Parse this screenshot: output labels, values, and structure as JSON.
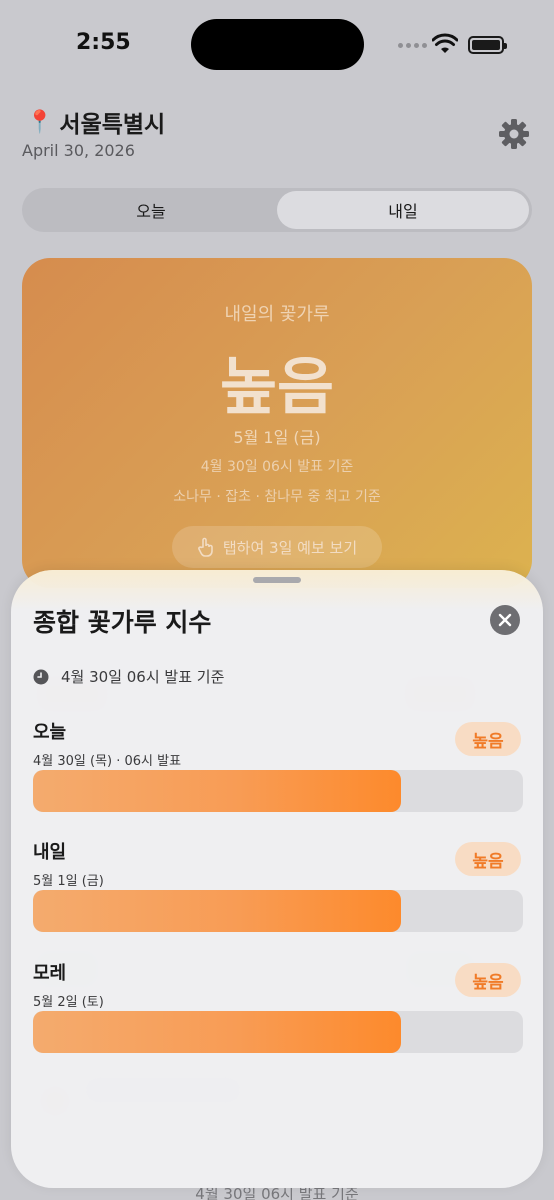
{
  "status_bar": {
    "time": "2:55"
  },
  "header": {
    "location_icon": "pin-icon",
    "city": "서울특별시",
    "date": "April 30, 2026",
    "settings_icon": "gear-icon"
  },
  "segment": {
    "tabs": [
      {
        "label": "오늘",
        "active": false
      },
      {
        "label": "내일",
        "active": true
      }
    ]
  },
  "hero": {
    "subtitle": "내일의 꽃가루",
    "level": "높음",
    "date": "5월 1일 (금)",
    "issued": "4월 30일 06시 발표 기준",
    "basis": "소나무 · 잡초 · 참나무 중 최고 기준",
    "button_label": "탭하여 3일 예보 보기",
    "button_icon": "tap-hand-icon",
    "color_from": "#d68c4e",
    "color_to": "#dcb24f"
  },
  "background_footer": "4월 30일 06시 발표 기준",
  "sheet": {
    "title": "종합 꽃가루 지수",
    "close_icon": "close-icon",
    "issued_icon": "clock-icon",
    "issued": "4월 30일 06시 발표 기준",
    "bar_color": "#fd8a2c",
    "badge_color": "#f07b28",
    "days": [
      {
        "name": "오늘",
        "date": "4월 30일 (목) · 06시 발표",
        "level": "높음",
        "fill": 0.75
      },
      {
        "name": "내일",
        "date": "5월 1일 (금)",
        "level": "높음",
        "fill": 0.75
      },
      {
        "name": "모레",
        "date": "5월 2일 (토)",
        "level": "높음",
        "fill": 0.75
      }
    ]
  }
}
